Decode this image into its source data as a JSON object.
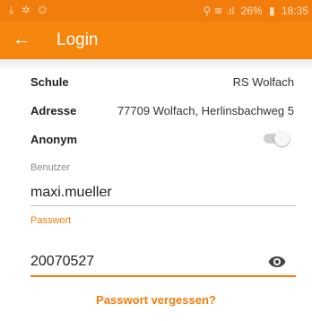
{
  "statusbar": {
    "left_icons": "⤓ ✲ ◎",
    "signal": "⚲ ≋ .ıl",
    "battery": "26%",
    "battery_icon": "▮",
    "time": "18:35"
  },
  "appbar": {
    "back_icon": "←",
    "title": "Login"
  },
  "form": {
    "school_label": "Schule",
    "school_value": "RS Wolfach",
    "address_label": "Adresse",
    "address_value": "77709 Wolfach, Herlinsbachweg 5",
    "anonymous_label": "Anonym",
    "anonymous_on": false,
    "username_label": "Benutzer",
    "username_value": "maxi.mueller",
    "password_label": "Passwort",
    "password_value": "20070527",
    "forgot_password": "Passwort vergessen?"
  },
  "colors": {
    "accent": "#f27d0d",
    "appbar": "#f5870f"
  }
}
